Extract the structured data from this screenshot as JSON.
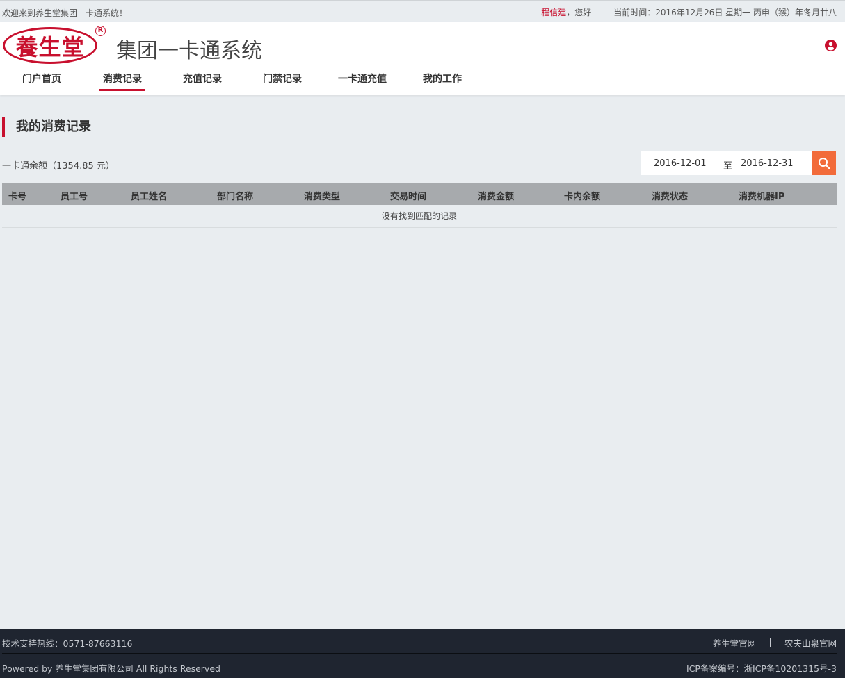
{
  "topbar": {
    "welcome": "欢迎来到养生堂集团一卡通系统！",
    "user_name": "程信建",
    "greeting": "，您好",
    "current_time": "当前时间：2016年12月26日  星期一  丙申（猴）年冬月廿八"
  },
  "header": {
    "logo_text": "養生堂",
    "logo_reg": "R",
    "system_title": "集团一卡通系统"
  },
  "nav": {
    "items": [
      {
        "label": "门户首页"
      },
      {
        "label": "消费记录"
      },
      {
        "label": "充值记录"
      },
      {
        "label": "门禁记录"
      },
      {
        "label": "一卡通充值"
      },
      {
        "label": "我的工作"
      }
    ],
    "active_index": 1
  },
  "main": {
    "section_title": "我的消费记录",
    "balance_text": "一卡通余额（1354.85 元）",
    "date_from": "2016-12-01",
    "date_to_label": "至",
    "date_to": "2016-12-31"
  },
  "table": {
    "columns": [
      "卡号",
      "员工号",
      "员工姓名",
      "部门名称",
      "消费类型",
      "交易时间",
      "消费金额",
      "卡内余额",
      "消费状态",
      "消费机器IP"
    ],
    "empty_message": "没有找到匹配的记录"
  },
  "footer": {
    "hotline": "技术支持热线：0571-87663116",
    "link1": "养生堂官网",
    "link2": "农夫山泉官网",
    "copyright": "Powered by 养生堂集团有限公司 All Rights Reserved",
    "icp": "ICP备案编号：浙ICP备10201315号-3"
  },
  "colors": {
    "brand_red": "#c8102e",
    "search_orange": "#f26b3a",
    "footer_bg": "#1f2530",
    "table_header_bg": "#a7aaad"
  }
}
